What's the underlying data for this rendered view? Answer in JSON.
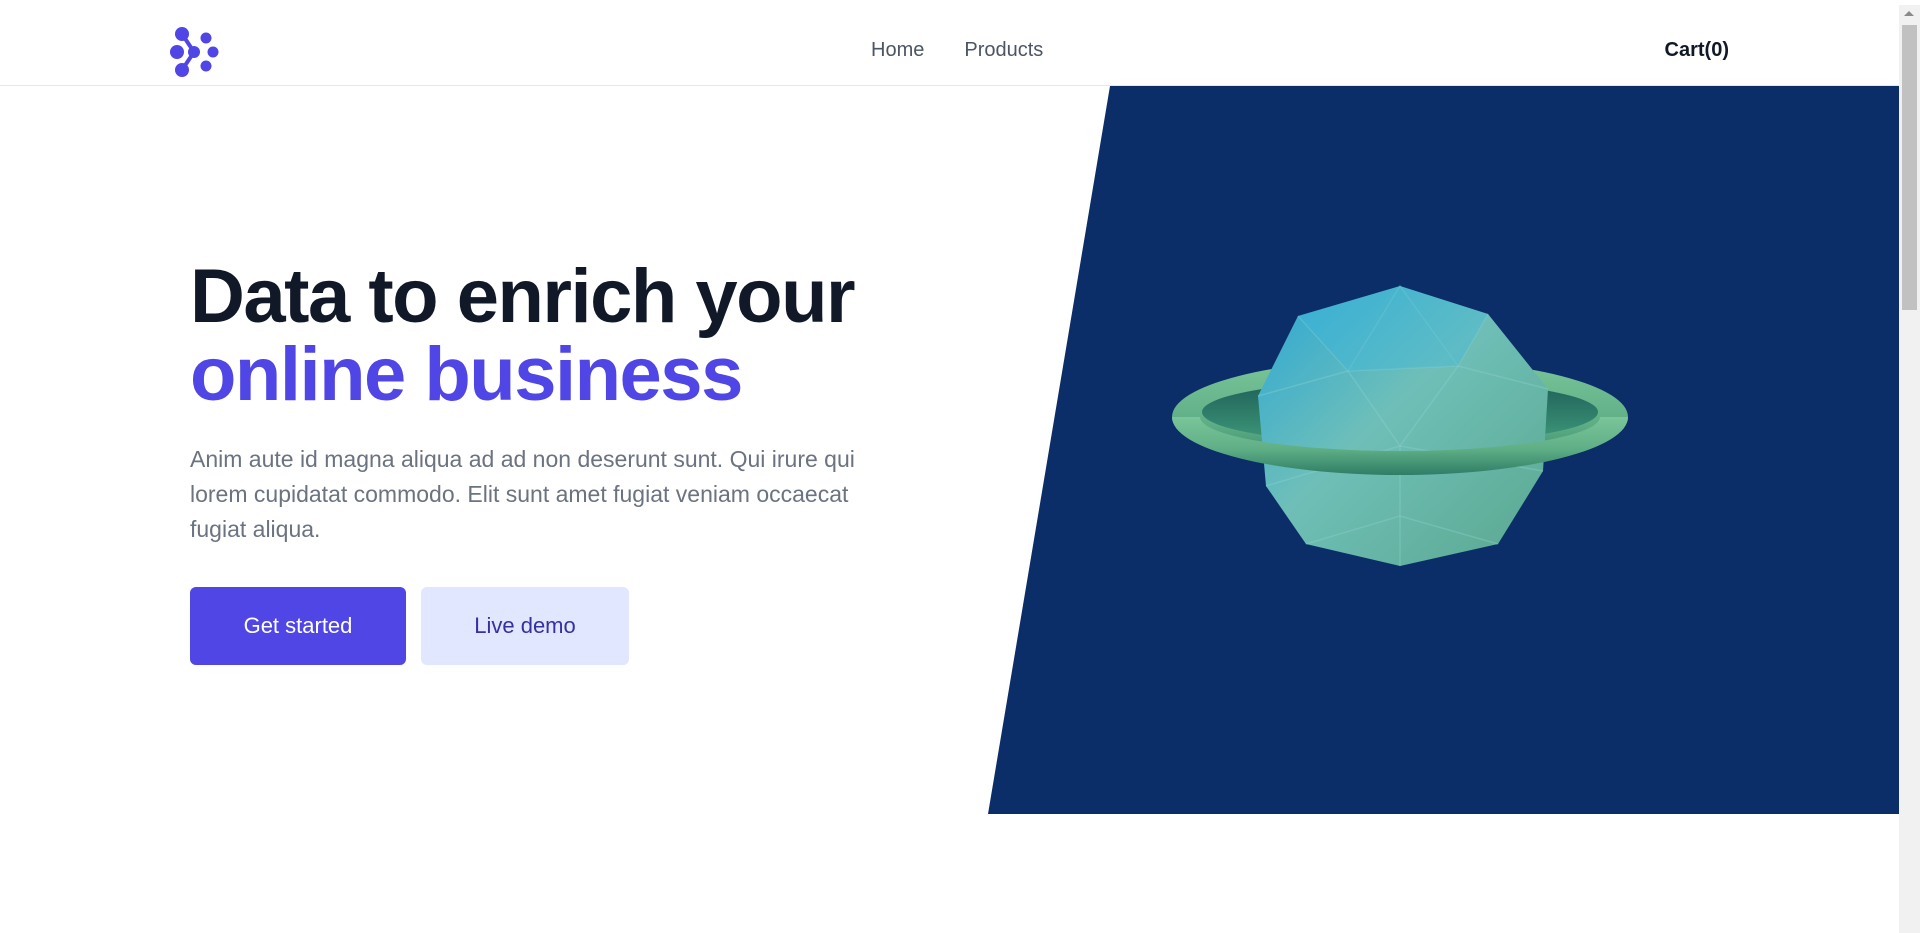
{
  "nav": {
    "links": [
      "Home",
      "Products"
    ],
    "cart": "Cart(0)"
  },
  "hero": {
    "headline_line1": "Data to enrich your",
    "headline_line2": "online business",
    "lead": "Anim aute id magna aliqua ad ad non deserunt sunt. Qui irure qui lorem cupidatat commodo. Elit sunt amet fugiat veniam occaecat fugiat aliqua.",
    "primary_button": "Get started",
    "secondary_button": "Live demo"
  },
  "colors": {
    "brand": "#4f46e5",
    "hero_panel": "#0b2e68",
    "headline": "#111827",
    "secondary_button_bg": "#e0e7ff"
  },
  "icons": {
    "logo": "molecule-logo-icon",
    "hero_image": "ringed-planet-illustration"
  }
}
